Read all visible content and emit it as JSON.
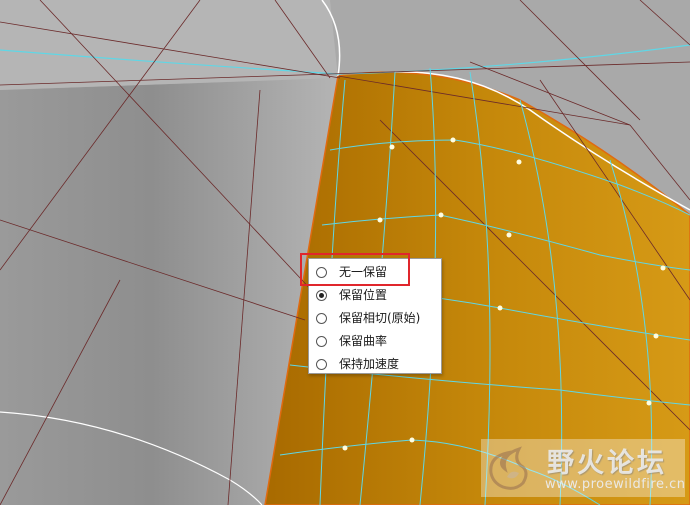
{
  "context_menu": {
    "items": [
      {
        "label": "无一保留",
        "selected": false
      },
      {
        "label": "保留位置",
        "selected": true
      },
      {
        "label": "保留相切(原始)",
        "selected": false
      },
      {
        "label": "保留曲率",
        "selected": false
      },
      {
        "label": "保持加速度",
        "selected": false
      }
    ]
  },
  "watermark": {
    "title": "野火论坛",
    "url": "www.proewildfire.cn"
  },
  "colors": {
    "background_gray": "#a6a6a6",
    "surface_orange": "#c98a0c",
    "mesh_cyan": "#5fd7e6",
    "edge_white": "#ffffff",
    "construction_line": "#6b2a2a",
    "highlight_red": "#e0262c"
  },
  "icons": {
    "radio": "radio-button-icon",
    "watermark_logo": "fire-logo-icon"
  }
}
